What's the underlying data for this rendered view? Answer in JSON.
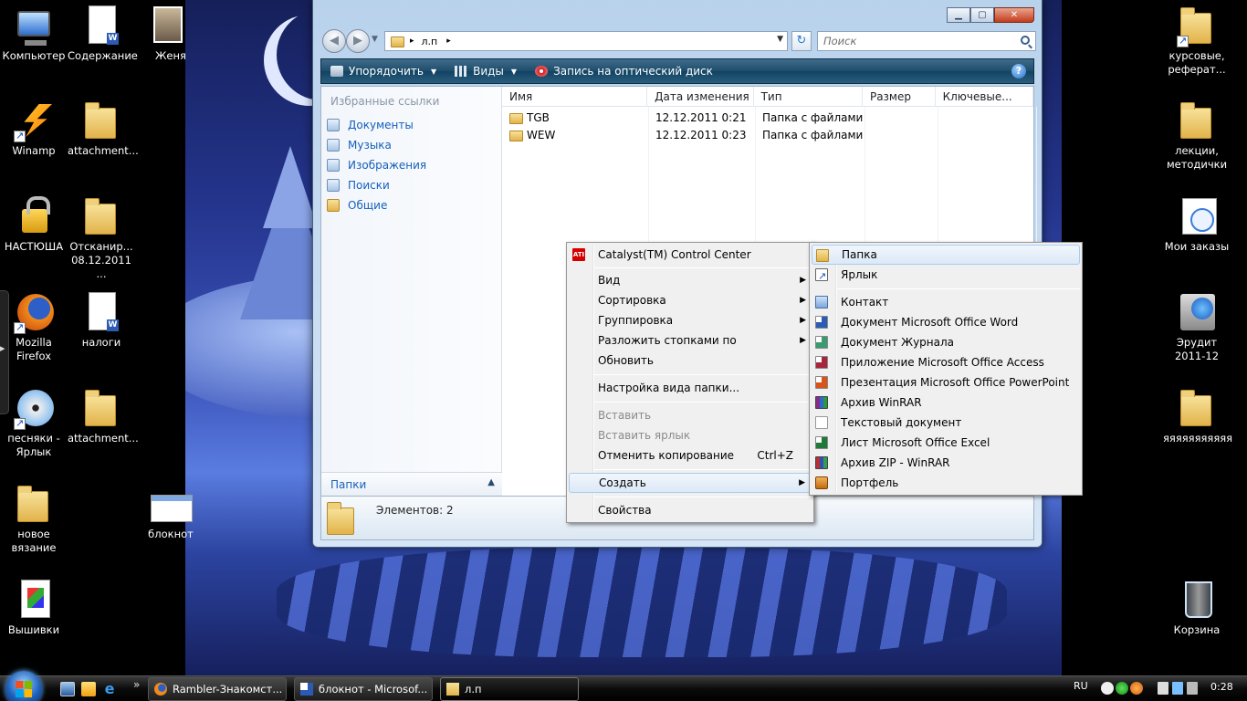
{
  "desktop": {
    "left_icons": [
      {
        "label": "Компьютер",
        "icon": "computer-icon"
      },
      {
        "label": "Содержание",
        "icon": "word-document-icon"
      },
      {
        "label": "Женя",
        "icon": "photo-icon"
      },
      {
        "label": "Winamp",
        "icon": "winamp-icon"
      },
      {
        "label": "attachment...",
        "icon": "folder-icon"
      },
      {
        "label": "НАСТЮША",
        "icon": "lock-icon"
      },
      {
        "label": "Отсканир... 08.12.2011 ...",
        "icon": "folder-icon"
      },
      {
        "label": "Mozilla Firefox",
        "icon": "firefox-icon"
      },
      {
        "label": "налоги",
        "icon": "word-document-icon"
      },
      {
        "label": "песняки - Ярлык",
        "icon": "cd-icon"
      },
      {
        "label": "attachment...",
        "icon": "folder-icon"
      },
      {
        "label": "новое вязание",
        "icon": "folder-icon"
      },
      {
        "label": "блокнот",
        "icon": "notepad-icon"
      },
      {
        "label": "Вышивки",
        "icon": "embroidery-icon"
      }
    ],
    "right_icons": [
      {
        "label": "курсовые, реферат...",
        "icon": "folder-icon"
      },
      {
        "label": "лекции, методички",
        "icon": "folder-icon"
      },
      {
        "label": "Мои заказы",
        "icon": "clock-icon"
      },
      {
        "label": "Эрудит 2011-12",
        "icon": "erudit-icon"
      },
      {
        "label": "яяяяяяяяяяя",
        "icon": "folder-icon"
      },
      {
        "label": "Корзина",
        "icon": "recycle-bin-icon"
      }
    ]
  },
  "explorer": {
    "window_buttons": {
      "minimize": "▁",
      "maximize": "▢",
      "close": "✕"
    },
    "nav": {
      "back": "◀",
      "forward": "▶",
      "history": "▼"
    },
    "address": {
      "crumb": "л.п",
      "sep": "▸",
      "dropdown": "▼"
    },
    "refresh": "↻",
    "search_placeholder": "Поиск",
    "toolbar": {
      "organize": "Упорядочить",
      "views": "Виды",
      "burn": "Запись на оптический диск",
      "help": "?"
    },
    "favorites_title": "Избранные ссылки",
    "favorites": [
      "Документы",
      "Музыка",
      "Изображения",
      "Поиски",
      "Общие"
    ],
    "folders_label": "Папки",
    "columns": [
      "Имя",
      "Дата изменения",
      "Тип",
      "Размер",
      "Ключевые..."
    ],
    "rows": [
      {
        "name": "TGB",
        "date": "12.12.2011 0:21",
        "type": "Папка с файлами"
      },
      {
        "name": "WEW",
        "date": "12.12.2011 0:23",
        "type": "Папка с файлами"
      }
    ],
    "item_count": "Элементов: 2"
  },
  "context_menu": {
    "items": [
      {
        "label": "Catalyst(TM) Control Center",
        "icon": "ati-icon"
      },
      {
        "label": "Вид",
        "submenu": true
      },
      {
        "label": "Сортировка",
        "submenu": true
      },
      {
        "label": "Группировка",
        "submenu": true
      },
      {
        "label": "Разложить стопками по",
        "submenu": true
      },
      {
        "label": "Обновить"
      },
      {
        "label": "Настройка вида папки..."
      },
      {
        "label": "Вставить",
        "disabled": true
      },
      {
        "label": "Вставить ярлык",
        "disabled": true
      },
      {
        "label": "Отменить копирование",
        "shortcut": "Ctrl+Z"
      },
      {
        "label": "Создать",
        "submenu": true,
        "highlighted": true
      },
      {
        "label": "Свойства"
      }
    ]
  },
  "create_submenu": {
    "items": [
      {
        "label": "Папка",
        "icon": "folder-icon",
        "highlighted": true
      },
      {
        "label": "Ярлык",
        "icon": "shortcut-icon"
      },
      {
        "label": "Контакт",
        "icon": "contact-icon"
      },
      {
        "label": "Документ Microsoft Office Word",
        "icon": "word-icon"
      },
      {
        "label": "Документ Журнала",
        "icon": "journal-icon"
      },
      {
        "label": "Приложение Microsoft Office Access",
        "icon": "access-icon"
      },
      {
        "label": "Презентация Microsoft Office PowerPoint",
        "icon": "powerpoint-icon"
      },
      {
        "label": "Архив WinRAR",
        "icon": "winrar-icon"
      },
      {
        "label": "Текстовый документ",
        "icon": "text-document-icon"
      },
      {
        "label": "Лист Microsoft Office Excel",
        "icon": "excel-icon"
      },
      {
        "label": "Архив ZIP - WinRAR",
        "icon": "zip-icon"
      },
      {
        "label": "Портфель",
        "icon": "briefcase-icon"
      }
    ]
  },
  "taskbar": {
    "tasks": [
      {
        "label": "Rambler-Знакомст...",
        "icon": "firefox-icon"
      },
      {
        "label": "блокнот - Microsof...",
        "icon": "word-icon"
      },
      {
        "label": "л.п",
        "icon": "folder-icon",
        "active": true
      }
    ],
    "quick_launch_more": "»",
    "ie_glyph": "e",
    "language": "RU",
    "clock": "0:28"
  },
  "colors": {
    "accent": "#1560bd",
    "toolbar": "#1d4d6b"
  }
}
